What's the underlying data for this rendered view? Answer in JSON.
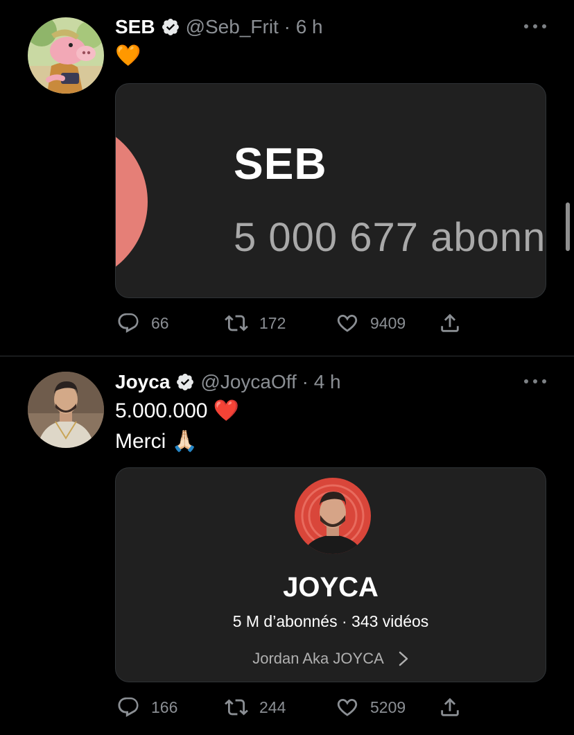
{
  "tweets": [
    {
      "author_name": "SEB",
      "handle_time": "@Seb_Frit · 6 h",
      "text_line1": "🧡",
      "card": {
        "channel_name": "SEB",
        "subscribers": "5 000 677 abonn"
      },
      "stats": {
        "replies": "66",
        "retweets": "172",
        "likes": "9409"
      }
    },
    {
      "author_name": "Joyca",
      "handle_time": "@JoycaOff · 4 h",
      "text_line1": "5.000.000 ❤️",
      "text_line2": "Merci 🙏🏻",
      "card": {
        "channel_name": "JOYCA",
        "stats": "5 M d’abonnés · 343 vidéos",
        "link": "Jordan Aka JOYCA"
      },
      "stats": {
        "replies": "166",
        "retweets": "244",
        "likes": "5209"
      }
    }
  ],
  "icons": [
    "verified-icon",
    "more-icon",
    "reply-icon",
    "retweet-icon",
    "like-icon",
    "share-icon",
    "chevron-right-icon"
  ],
  "colors": {
    "background": "#000000",
    "muted": "#8b8f94",
    "card": "#202020",
    "card_accent": "#e57f77"
  }
}
